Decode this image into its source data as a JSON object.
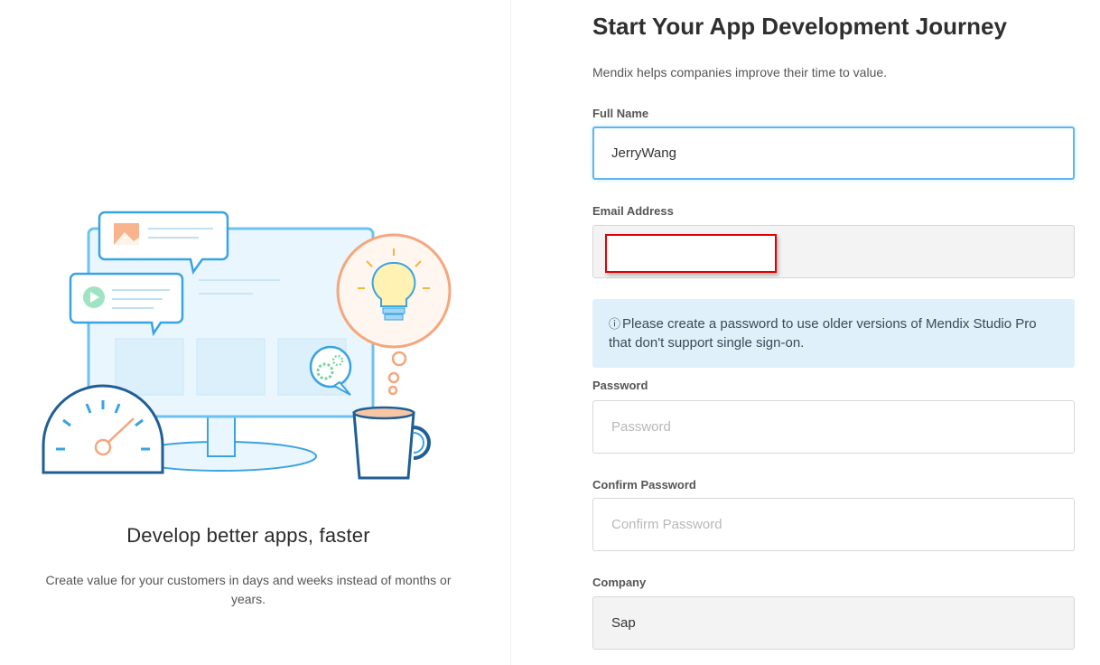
{
  "promo": {
    "title": "Develop better apps, faster",
    "text": "Create value for your customers in days and weeks instead of months or years."
  },
  "form": {
    "title": "Start Your App Development Journey",
    "subtitle": "Mendix helps companies improve their time to value.",
    "full_name": {
      "label": "Full Name",
      "value": "JerryWang"
    },
    "email": {
      "label": "Email Address",
      "value": ""
    },
    "info": {
      "icon": "info-circle-icon",
      "text": "Please create a password to use older versions of Mendix Studio Pro that don't support single sign-on."
    },
    "password": {
      "label": "Password",
      "placeholder": "Password",
      "value": ""
    },
    "confirm_password": {
      "label": "Confirm Password",
      "placeholder": "Confirm Password",
      "value": ""
    },
    "company": {
      "label": "Company",
      "value": "Sap"
    }
  },
  "colors": {
    "focus_border": "#5eb6f0",
    "info_bg": "#dff0fb",
    "illustration_blue": "#3aa3e3",
    "illustration_orange": "#f5a67c",
    "redaction_border": "#e00000"
  }
}
